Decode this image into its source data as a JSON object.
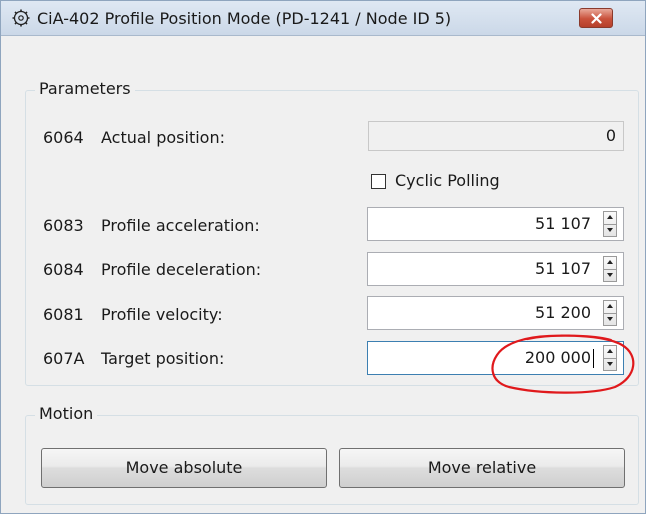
{
  "window": {
    "title": "CiA-402 Profile Position Mode (PD-1241 / Node ID  5)",
    "icon": "gear-icon",
    "close_icon": "close-icon"
  },
  "parameters": {
    "group_label": "Parameters",
    "actual_position": {
      "code": "6064",
      "label": "Actual position:",
      "value": "0"
    },
    "cyclic_polling": {
      "label": "Cyclic Polling",
      "checked": false
    },
    "profile_acceleration": {
      "code": "6083",
      "label": "Profile acceleration:",
      "value": "51 107"
    },
    "profile_deceleration": {
      "code": "6084",
      "label": "Profile deceleration:",
      "value": "51 107"
    },
    "profile_velocity": {
      "code": "6081",
      "label": "Profile velocity:",
      "value": "51 200"
    },
    "target_position": {
      "code": "607A",
      "label": "Target position:",
      "value": "200 000"
    }
  },
  "motion": {
    "group_label": "Motion",
    "move_absolute_label": "Move absolute",
    "move_relative_label": "Move relative"
  },
  "colors": {
    "annotation": "#e0191c",
    "focus_border": "#3c7fb1"
  }
}
